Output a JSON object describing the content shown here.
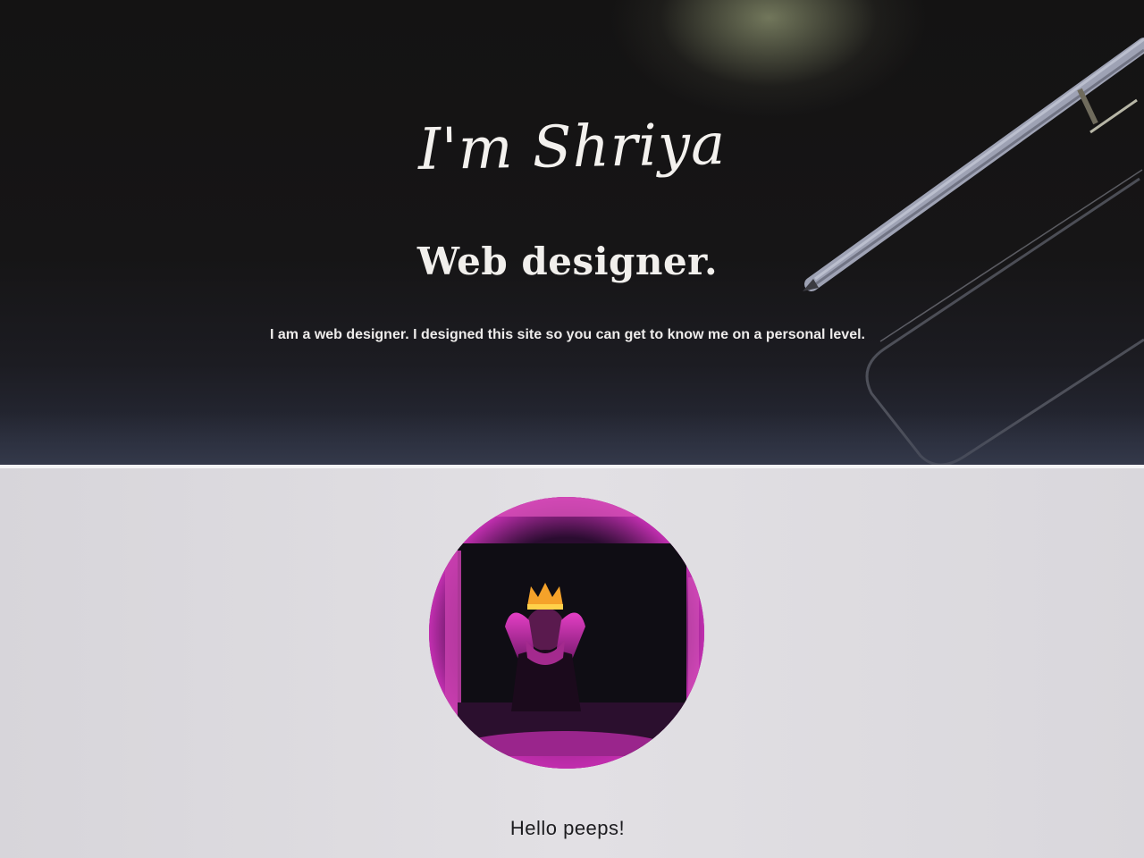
{
  "hero": {
    "title": "I'm Shriya",
    "subtitle": "Web designer.",
    "description": "I am a web designer. I designed this site so you can get to know me on a personal level."
  },
  "about": {
    "avatar_icon": "profile-photo",
    "greeting": "Hello peeps!"
  },
  "colors": {
    "hero_background": "#151414",
    "hero_text": "#f3f1ee",
    "about_background": "#dddbe0",
    "avatar_accent": "#c22fb0",
    "greeting_text": "#1d1d20"
  }
}
